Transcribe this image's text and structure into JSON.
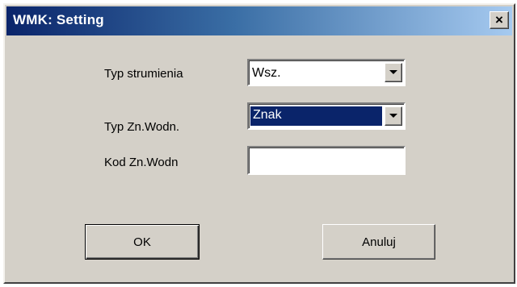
{
  "window": {
    "title": "WMK: Setting",
    "close_label": "×"
  },
  "form": {
    "stream_type": {
      "label": "Typ strumienia",
      "value": "Wsz."
    },
    "watermark_type": {
      "label": "Typ Zn.Wodn.",
      "value": "Znak"
    },
    "watermark_code": {
      "label": "Kod Zn.Wodn",
      "value": "",
      "placeholder": ""
    }
  },
  "buttons": {
    "ok_label": "OK",
    "cancel_label": "Anuluj"
  },
  "icons": {
    "dropdown": "chevron-down-icon",
    "close": "close-icon"
  },
  "colors": {
    "title_start": "#0a246a",
    "title_end": "#a6caf0",
    "face": "#d4d0c8",
    "selection": "#0a246a"
  }
}
